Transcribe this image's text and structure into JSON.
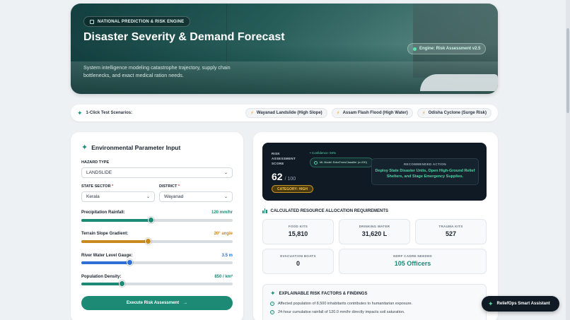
{
  "hero": {
    "badge": "NATIONAL PREDICTION & RISK ENGINE",
    "title": "Disaster Severity & Demand Forecast",
    "description": "System intelligence modeling catastrophe trajectory, supply chain bottlenecks, and exact medical ration needs.",
    "engine_badge": "Engine: Risk Assessment v2.5"
  },
  "scenarios": {
    "label": "1-Click Test Scenarios:",
    "items": [
      "Wayanad Landslide (High Slope)",
      "Assam Flash Flood (High Water)",
      "Odisha Cyclone (Surge Risk)"
    ]
  },
  "input_panel": {
    "title": "Environmental Parameter Input",
    "hazard_type_label": "HAZARD TYPE",
    "hazard_type_value": "LANDSLIDE",
    "state_label": "STATE SECTOR",
    "state_value": "Kerala",
    "district_label": "DISTRICT",
    "district_value": "Wayanad",
    "sliders": [
      {
        "label": "Precipitation Rainfall:",
        "value": "120 mm/hr",
        "fraction": 0.46,
        "color": "#1d8a76"
      },
      {
        "label": "Terrain Slope Gradient:",
        "value": "20° angle",
        "fraction": 0.44,
        "color": "#c98a1f"
      },
      {
        "label": "River Water Level Gauge:",
        "value": "3.5 m",
        "fraction": 0.32,
        "color": "#2f6fd6"
      },
      {
        "label": "Population Density:",
        "value": "850 / km²",
        "fraction": 0.27,
        "color": "#1d8a76"
      }
    ],
    "execute_label": "Execute Risk Assessment"
  },
  "risk": {
    "label": "RISK ASSESSMENT SCORE",
    "confidence": "• Confidence: 94%",
    "model": "ML Model: ExtraTreesClassifier (n=200)",
    "score": "62",
    "out_of": "/ 100",
    "category": "CATEGORY: HIGH",
    "action_label": "RECOMMENDED ACTION",
    "action_text": "Deploy State Disaster Units, Open High-Ground Relief Shelters, and Stage Emergency Supplies."
  },
  "resources": {
    "title": "CALCULATED RESOURCE ALLOCATION REQUIREMENTS",
    "food_label": "FOOD KITS",
    "food_value": "15,810",
    "water_label": "DRINKING WATER",
    "water_value": "31,620 L",
    "trauma_label": "TRAUMA KITS",
    "trauma_value": "527",
    "boats_label": "EVACUATION BOATS",
    "boats_value": "0",
    "ndrf_label": "NDRF CADRE NEEDED",
    "ndrf_value": "105 Officers"
  },
  "risk_factors": {
    "title": "EXPLAINABLE RISK FACTORS & FINDINGS",
    "items": [
      "Affected population of 8,500 inhabitants contributes to humanitarian exposure.",
      "24-hour cumulative rainfall of 120.0 mm/hr directly impacts soil saturation."
    ]
  },
  "assistant": {
    "label": "ReliefOps Smart Assistant"
  }
}
